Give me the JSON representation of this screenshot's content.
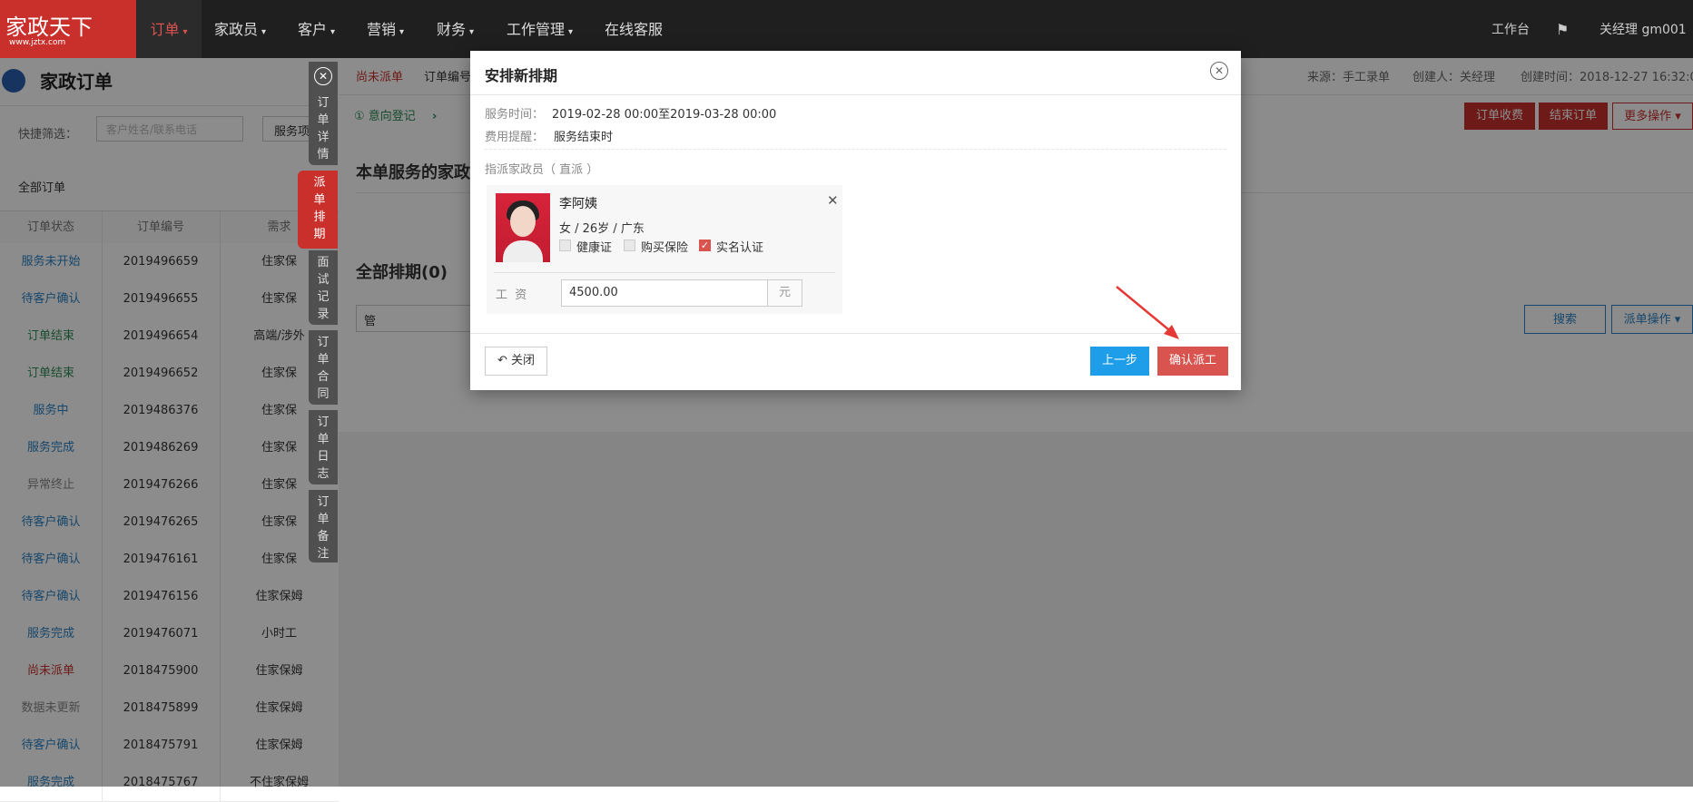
{
  "brand": {
    "logo_text": "家政天下",
    "logo_url": "www.jztx.com"
  },
  "nav": {
    "items": [
      {
        "label": "订单",
        "caret": true
      },
      {
        "label": "家政员",
        "caret": true
      },
      {
        "label": "客户",
        "caret": true
      },
      {
        "label": "营销",
        "caret": true
      },
      {
        "label": "财务",
        "caret": true
      },
      {
        "label": "工作管理",
        "caret": true
      },
      {
        "label": "在线客服",
        "caret": false
      }
    ],
    "workbench": "工作台",
    "user": "关经理 gm001"
  },
  "left": {
    "title": "家政订单",
    "filter_label": "快捷筛选：",
    "filter_placeholder": "客户姓名/联系电话",
    "filter_button": "服务项",
    "all_orders": "全部订单",
    "columns": [
      "订单状态",
      "订单编号",
      "需求"
    ],
    "rows": [
      {
        "status": "服务未开始",
        "color": "#2b82c5",
        "id": "2019496659",
        "need": "住家保"
      },
      {
        "status": "待客户确认",
        "color": "#2b82c5",
        "id": "2019496655",
        "need": "住家保"
      },
      {
        "status": "订单结束",
        "color": "#2e8b57",
        "id": "2019496654",
        "need": "高端/涉外"
      },
      {
        "status": "订单结束",
        "color": "#2e8b57",
        "id": "2019496652",
        "need": "住家保"
      },
      {
        "status": "服务中",
        "color": "#2b82c5",
        "id": "2019486376",
        "need": "住家保"
      },
      {
        "status": "服务完成",
        "color": "#2b82c5",
        "id": "2019486269",
        "need": "住家保"
      },
      {
        "status": "异常终止",
        "color": "#888888",
        "id": "2019476266",
        "need": "住家保"
      },
      {
        "status": "待客户确认",
        "color": "#2b82c5",
        "id": "2019476265",
        "need": "住家保"
      },
      {
        "status": "待客户确认",
        "color": "#2b82c5",
        "id": "2019476161",
        "need": "住家保"
      },
      {
        "status": "待客户确认",
        "color": "#2b82c5",
        "id": "2019476156",
        "need": "住家保姆"
      },
      {
        "status": "服务完成",
        "color": "#2b82c5",
        "id": "2019476071",
        "need": "小时工"
      },
      {
        "status": "尚未派单",
        "color": "#c9302c",
        "id": "2018475900",
        "need": "住家保姆"
      },
      {
        "status": "数据未更新",
        "color": "#888888",
        "id": "2018475899",
        "need": "住家保姆"
      },
      {
        "status": "待客户确认",
        "color": "#2b82c5",
        "id": "2018475791",
        "need": "住家保姆"
      },
      {
        "status": "服务完成",
        "color": "#2b82c5",
        "id": "2018475767",
        "need": "不住家保姆"
      }
    ]
  },
  "side_tabs": {
    "details": "订单详情",
    "dispatch": "派单排期",
    "interview": "面试记录",
    "contract": "订单合同",
    "log": "订单日志",
    "remarks": "订单备注"
  },
  "main": {
    "status_tag": "尚未派单",
    "order_no_label": "订单编号",
    "step1": "① 意向登记",
    "source": "来源：手工录单",
    "creator": "创建人：关经理",
    "created": "创建时间：2018-12-27 16:32:0",
    "btn_charge": "订单收费",
    "btn_end": "结束订单",
    "btn_more": "更多操作",
    "section_staff": "本单服务的家政",
    "section_schedule": "全部排期(0)",
    "filter_value": "管",
    "btn_search": "搜索",
    "btn_dispatch_ops": "派单操作"
  },
  "modal": {
    "title": "安排新排期",
    "service_time_label": "服务时间：",
    "service_time": "2019-02-28 00:00至2019-03-28 00:00",
    "fee_label": "费用提醒：",
    "fee_value": "服务结束时",
    "assign_label": "指派家政员（ 直派 ）",
    "worker": {
      "name": "李阿姨",
      "info": "女 / 26岁 / 广东",
      "checks": [
        {
          "label": "健康证",
          "checked": false
        },
        {
          "label": "购买保险",
          "checked": false
        },
        {
          "label": "实名认证",
          "checked": true
        }
      ],
      "salary_label": "工  资",
      "salary": "4500.00",
      "salary_unit": "元"
    },
    "btn_close": "关闭",
    "btn_prev": "上一步",
    "btn_confirm": "确认派工"
  }
}
